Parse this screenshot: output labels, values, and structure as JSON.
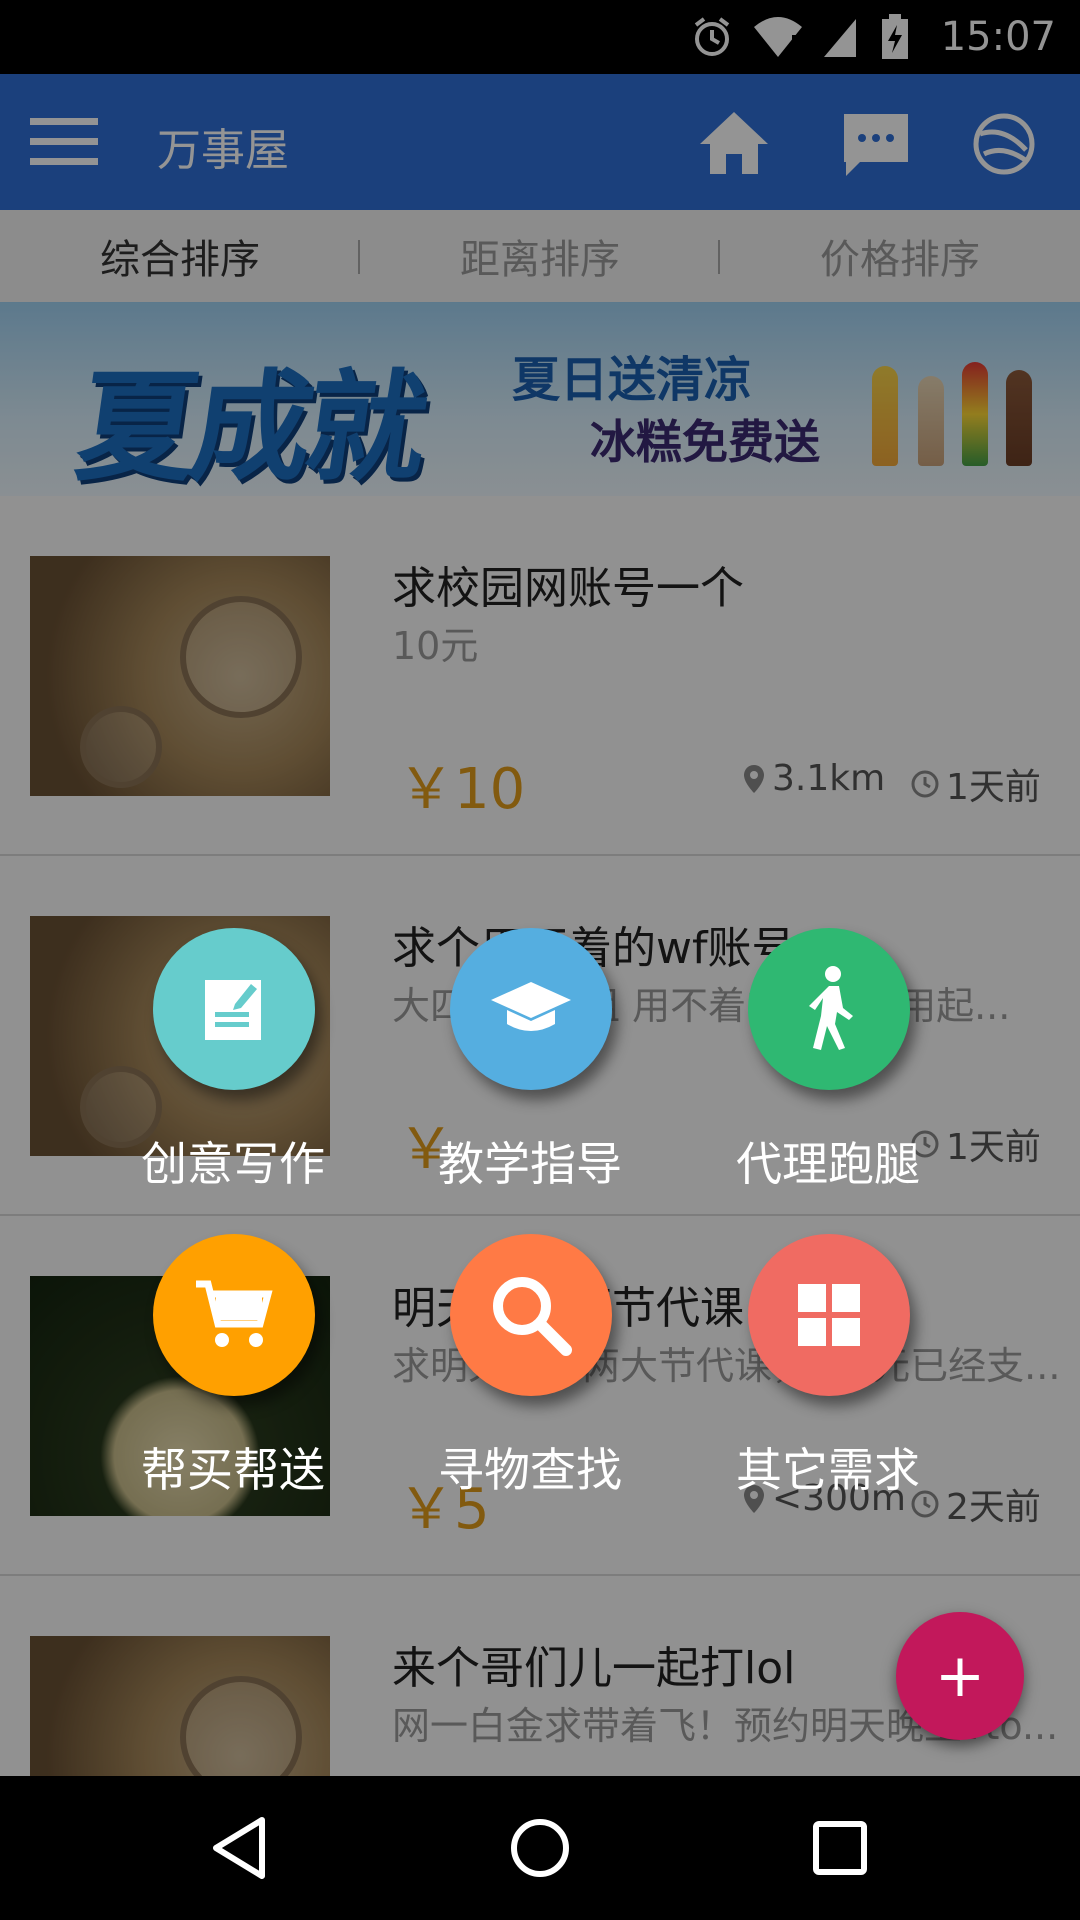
{
  "status_bar": {
    "time": "15:07"
  },
  "app_bar": {
    "title": "万事屋"
  },
  "sort_tabs": [
    {
      "label": "综合排序"
    },
    {
      "label": "距离排序"
    },
    {
      "label": "价格排序"
    }
  ],
  "banner": {
    "headline": "夏成就",
    "line1": "夏日送清凉",
    "line2": "冰糕免费送"
  },
  "items": [
    {
      "title": "求校园网账号一个",
      "desc": "10元",
      "price": "￥10",
      "distance": "3.1km",
      "time": "1天前"
    },
    {
      "title": "求个用不着的wf账号...",
      "desc": "大四学长学姐 用不着的快快利用起...",
      "price": "￥",
      "distance": "",
      "time": "1天前"
    },
    {
      "title": "明天下午两节代课",
      "desc": "求明天下午两大节代课，给5元已经支...",
      "price": "￥5",
      "distance": "<300m",
      "time": "2天前"
    },
    {
      "title": "来个哥们儿一起打lol",
      "desc": "网一白金求带着飞！预约明天晚上vto...",
      "price": "",
      "distance": "",
      "time": ""
    }
  ],
  "categories": [
    {
      "label": "创意写作",
      "icon": "note-edit-icon",
      "color": "#66cccc"
    },
    {
      "label": "教学指导",
      "icon": "graduation-cap-icon",
      "color": "#55aee0"
    },
    {
      "label": "代理跑腿",
      "icon": "walking-person-icon",
      "color": "#2fb872"
    },
    {
      "label": "帮买帮送",
      "icon": "shopping-cart-icon",
      "color": "#ffa000"
    },
    {
      "label": "寻物查找",
      "icon": "search-icon",
      "color": "#ff7a45"
    },
    {
      "label": "其它需求",
      "icon": "grid-icon",
      "color": "#f06b62"
    }
  ],
  "fab": {
    "label": "+",
    "color": "#c2185b"
  },
  "colors": {
    "app_bar": "#2f6fd6",
    "price": "#e19b1a"
  }
}
